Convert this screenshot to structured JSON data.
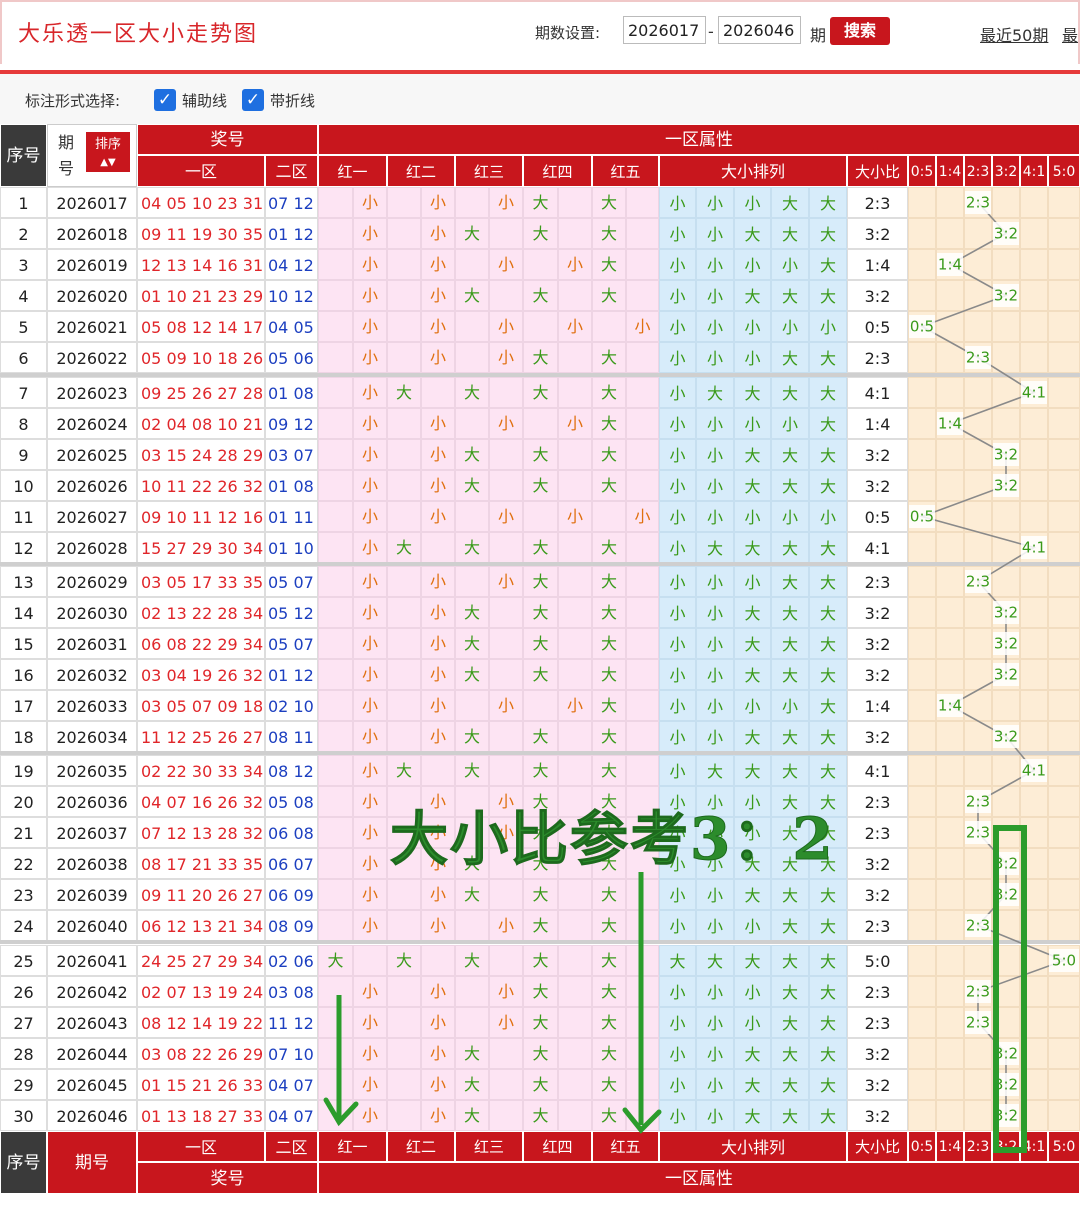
{
  "header": {
    "title": "大乐透一区大小走势图",
    "period_label": "期数设置:",
    "period_start": "2026017",
    "period_end": "2026046",
    "dash": "-",
    "period_unit": "期",
    "search_label": "搜索",
    "recent_label": "最近50期",
    "recent_label_cut": "最"
  },
  "marking": {
    "label": "标注形式选择:",
    "options": [
      {
        "label": "辅助线",
        "checked": true,
        "check_glyph": "✓"
      },
      {
        "label": "带折线",
        "checked": true,
        "check_glyph": "✓"
      }
    ]
  },
  "table": {
    "head": {
      "seq": "序号",
      "period": "期号",
      "sort": "排序",
      "sort_arrows": "▲▼",
      "award": "奖号",
      "zone_attr": "一区属性",
      "zone1": "一区",
      "zone2": "二区",
      "reds": [
        "红一",
        "红二",
        "红三",
        "红四",
        "红五"
      ],
      "arrangement": "大小排列",
      "ratio": "大小比",
      "ratio_options": [
        "0:5",
        "1:4",
        "2:3",
        "3:2",
        "4:1",
        "5:0"
      ]
    },
    "rows": [
      {
        "seq": "1",
        "period": "2026017",
        "red": "04 05 10 23 31",
        "blue": "07 12",
        "bs": "小小小大大",
        "ratio": "2:3"
      },
      {
        "seq": "2",
        "period": "2026018",
        "red": "09 11 19 30 35",
        "blue": "01 12",
        "bs": "小小大大大",
        "ratio": "3:2"
      },
      {
        "seq": "3",
        "period": "2026019",
        "red": "12 13 14 16 31",
        "blue": "04 12",
        "bs": "小小小小大",
        "ratio": "1:4"
      },
      {
        "seq": "4",
        "period": "2026020",
        "red": "01 10 21 23 29",
        "blue": "10 12",
        "bs": "小小大大大",
        "ratio": "3:2"
      },
      {
        "seq": "5",
        "period": "2026021",
        "red": "05 08 12 14 17",
        "blue": "04 05",
        "bs": "小小小小小",
        "ratio": "0:5"
      },
      {
        "seq": "6",
        "period": "2026022",
        "red": "05 09 10 18 26",
        "blue": "05 06",
        "bs": "小小小大大",
        "ratio": "2:3"
      },
      {
        "seq": "7",
        "period": "2026023",
        "red": "09 25 26 27 28",
        "blue": "01 08",
        "bs": "小大大大大",
        "ratio": "4:1"
      },
      {
        "seq": "8",
        "period": "2026024",
        "red": "02 04 08 10 21",
        "blue": "09 12",
        "bs": "小小小小大",
        "ratio": "1:4"
      },
      {
        "seq": "9",
        "period": "2026025",
        "red": "03 15 24 28 29",
        "blue": "03 07",
        "bs": "小小大大大",
        "ratio": "3:2"
      },
      {
        "seq": "10",
        "period": "2026026",
        "red": "10 11 22 26 32",
        "blue": "01 08",
        "bs": "小小大大大",
        "ratio": "3:2"
      },
      {
        "seq": "11",
        "period": "2026027",
        "red": "09 10 11 12 16",
        "blue": "01 11",
        "bs": "小小小小小",
        "ratio": "0:5"
      },
      {
        "seq": "12",
        "period": "2026028",
        "red": "15 27 29 30 34",
        "blue": "01 10",
        "bs": "小大大大大",
        "ratio": "4:1"
      },
      {
        "seq": "13",
        "period": "2026029",
        "red": "03 05 17 33 35",
        "blue": "05 07",
        "bs": "小小小大大",
        "ratio": "2:3"
      },
      {
        "seq": "14",
        "period": "2026030",
        "red": "02 13 22 28 34",
        "blue": "05 12",
        "bs": "小小大大大",
        "ratio": "3:2"
      },
      {
        "seq": "15",
        "period": "2026031",
        "red": "06 08 22 29 34",
        "blue": "05 07",
        "bs": "小小大大大",
        "ratio": "3:2"
      },
      {
        "seq": "16",
        "period": "2026032",
        "red": "03 04 19 26 32",
        "blue": "01 12",
        "bs": "小小大大大",
        "ratio": "3:2"
      },
      {
        "seq": "17",
        "period": "2026033",
        "red": "03 05 07 09 18",
        "blue": "02 10",
        "bs": "小小小小大",
        "ratio": "1:4"
      },
      {
        "seq": "18",
        "period": "2026034",
        "red": "11 12 25 26 27",
        "blue": "08 11",
        "bs": "小小大大大",
        "ratio": "3:2"
      },
      {
        "seq": "19",
        "period": "2026035",
        "red": "02 22 30 33 34",
        "blue": "08 12",
        "bs": "小大大大大",
        "ratio": "4:1"
      },
      {
        "seq": "20",
        "period": "2026036",
        "red": "04 07 16 26 32",
        "blue": "05 08",
        "bs": "小小小大大",
        "ratio": "2:3"
      },
      {
        "seq": "21",
        "period": "2026037",
        "red": "07 12 13 28 32",
        "blue": "06 08",
        "bs": "小小小大大",
        "ratio": "2:3"
      },
      {
        "seq": "22",
        "period": "2026038",
        "red": "08 17 21 33 35",
        "blue": "06 07",
        "bs": "小小大大大",
        "ratio": "3:2"
      },
      {
        "seq": "23",
        "period": "2026039",
        "red": "09 11 20 26 27",
        "blue": "06 09",
        "bs": "小小大大大",
        "ratio": "3:2"
      },
      {
        "seq": "24",
        "period": "2026040",
        "red": "06 12 13 21 34",
        "blue": "08 09",
        "bs": "小小小大大",
        "ratio": "2:3"
      },
      {
        "seq": "25",
        "period": "2026041",
        "red": "24 25 27 29 34",
        "blue": "02 06",
        "bs": "大大大大大",
        "ratio": "5:0"
      },
      {
        "seq": "26",
        "period": "2026042",
        "red": "02 07 13 19 24",
        "blue": "03 08",
        "bs": "小小小大大",
        "ratio": "2:3"
      },
      {
        "seq": "27",
        "period": "2026043",
        "red": "08 12 14 19 22",
        "blue": "11 12",
        "bs": "小小小大大",
        "ratio": "2:3"
      },
      {
        "seq": "28",
        "period": "2026044",
        "red": "03 08 22 26 29",
        "blue": "07 10",
        "bs": "小小大大大",
        "ratio": "3:2"
      },
      {
        "seq": "29",
        "period": "2026045",
        "red": "01 15 21 26 33",
        "blue": "04 07",
        "bs": "小小大大大",
        "ratio": "3:2"
      },
      {
        "seq": "30",
        "period": "2026046",
        "red": "01 13 18 27 33",
        "blue": "04 07",
        "bs": "小小大大大",
        "ratio": "3:2"
      }
    ]
  },
  "annotation": {
    "text": "大小比参考3：2"
  },
  "colors": {
    "header_red": "#c8161d",
    "red_number": "#e0262a",
    "blue_number": "#1c3fc0",
    "green_mark": "#3a9a1a",
    "red_attr_mark": "#e07010",
    "pink_band": "#fde4f3",
    "blue_band": "#d7ecfa",
    "cream_band": "#fdedd6",
    "annotation_green": "#2c9c2c"
  }
}
